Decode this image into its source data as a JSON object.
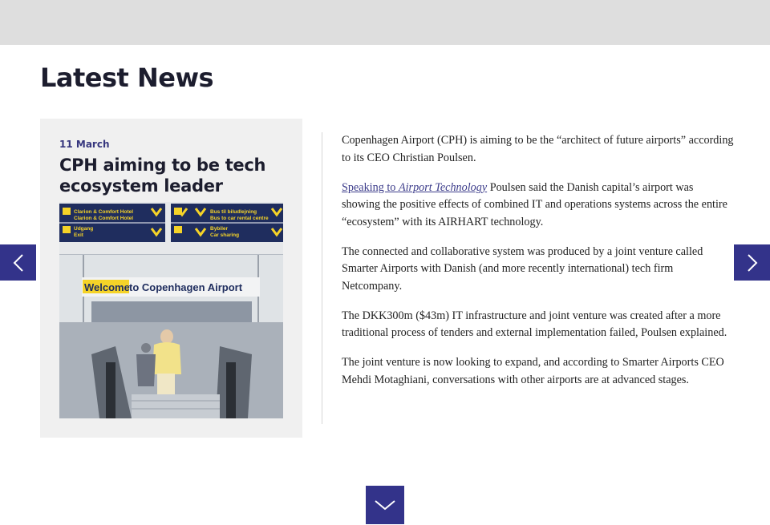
{
  "section": {
    "heading": "Latest News"
  },
  "card": {
    "date": "11 March",
    "title": "CPH aiming to be tech ecosystem leader",
    "image": {
      "signs": {
        "left_top": "Clarion & Comfort Hotel",
        "left_top2": "Clarion & Comfort Hotel",
        "left_bottom_1": "Udgang",
        "left_bottom_2": "Exit",
        "right_top_1": "Bus til biludlejning",
        "right_top_2": "Bus to car rental centre",
        "right_bottom_1": "Bybiler",
        "right_bottom_2": "Car sharing"
      },
      "banner_highlight": "Welcome",
      "banner_rest": " to Copenhagen Airport"
    }
  },
  "article": {
    "p1": "Copenhagen Airport (CPH) is aiming to be the “architect of future airports” according to its CEO Christian Poulsen.",
    "p2_link_prefix": "Speaking to ",
    "p2_link_italic": "Airport Technology",
    "p2_rest": " Poulsen said the Danish capital’s airport was showing the positive effects of combined IT and operations systems across the entire “ecosystem” with its AIRHART technology.",
    "p3": "The connected and collaborative system was produced by a joint venture called Smarter Airports with Danish (and more recently international) tech firm Netcompany.",
    "p4": "The DKK300m ($43m) IT infrastructure and joint venture was created after a more traditional process of tenders and external implementation failed, Poulsen explained.",
    "p5": "The joint venture is now looking to expand, and according to Smarter Airports CEO Mehdi Motaghiani, conversations with other airports are at advanced stages."
  },
  "icons": {
    "prev": "chevron-left-icon",
    "next": "chevron-right-icon",
    "down": "chevron-down-icon"
  },
  "colors": {
    "accent": "#33338a",
    "card_bg": "#f0f0f0",
    "top_bar": "#dedede",
    "sign_blue": "#1f2d5e",
    "sign_yellow": "#f5d328"
  }
}
